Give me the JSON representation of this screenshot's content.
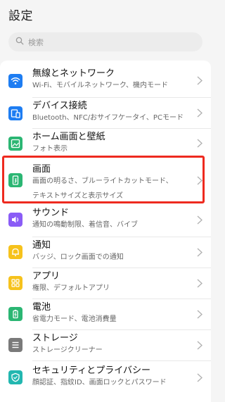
{
  "header": {
    "title": "設定"
  },
  "search": {
    "placeholder": "検索"
  },
  "items": [
    {
      "label": "無線とネットワーク",
      "sub": "Wi-Fi、モバイルネットワーク、機内モード",
      "icon": "wifi-icon",
      "color": "#1e7df2"
    },
    {
      "label": "デバイス接続",
      "sub": "Bluetooth、NFC/おサイフケータイ、PCモード",
      "icon": "device-connect-icon",
      "color": "#1e7df2"
    },
    {
      "label": "ホーム画面と壁紙",
      "sub": "フォト表示",
      "icon": "wallpaper-icon",
      "color": "#2bb673"
    },
    {
      "label": "画面",
      "sub": "画面の明るさ、ブルーライトカットモード、",
      "sub2": "テキストサイズと表示サイズ",
      "icon": "display-icon",
      "color": "#2bb673"
    },
    {
      "label": "サウンド",
      "sub": "通知の鳴動制限、着信音、バイブ",
      "icon": "sound-icon",
      "color": "#8a5cf6"
    },
    {
      "label": "通知",
      "sub": "バッジ、ロック画面での通知",
      "icon": "notification-icon",
      "color": "#f6c21c"
    },
    {
      "label": "アプリ",
      "sub": "権限、デフォルトアプリ",
      "icon": "apps-icon",
      "color": "#f6c21c"
    },
    {
      "label": "電池",
      "sub": "省電力モード、電池消費量",
      "icon": "battery-icon",
      "color": "#2bb673"
    },
    {
      "label": "ストレージ",
      "sub": "ストレージクリーナー",
      "icon": "storage-icon",
      "color": "#7a7a7a"
    },
    {
      "label": "セキュリティとプライバシー",
      "sub": "顔認証、指紋ID、画面ロックとパスワード",
      "icon": "security-icon",
      "color": "#22b7b0"
    }
  ],
  "highlight": {
    "color": "#ee2a1f"
  }
}
